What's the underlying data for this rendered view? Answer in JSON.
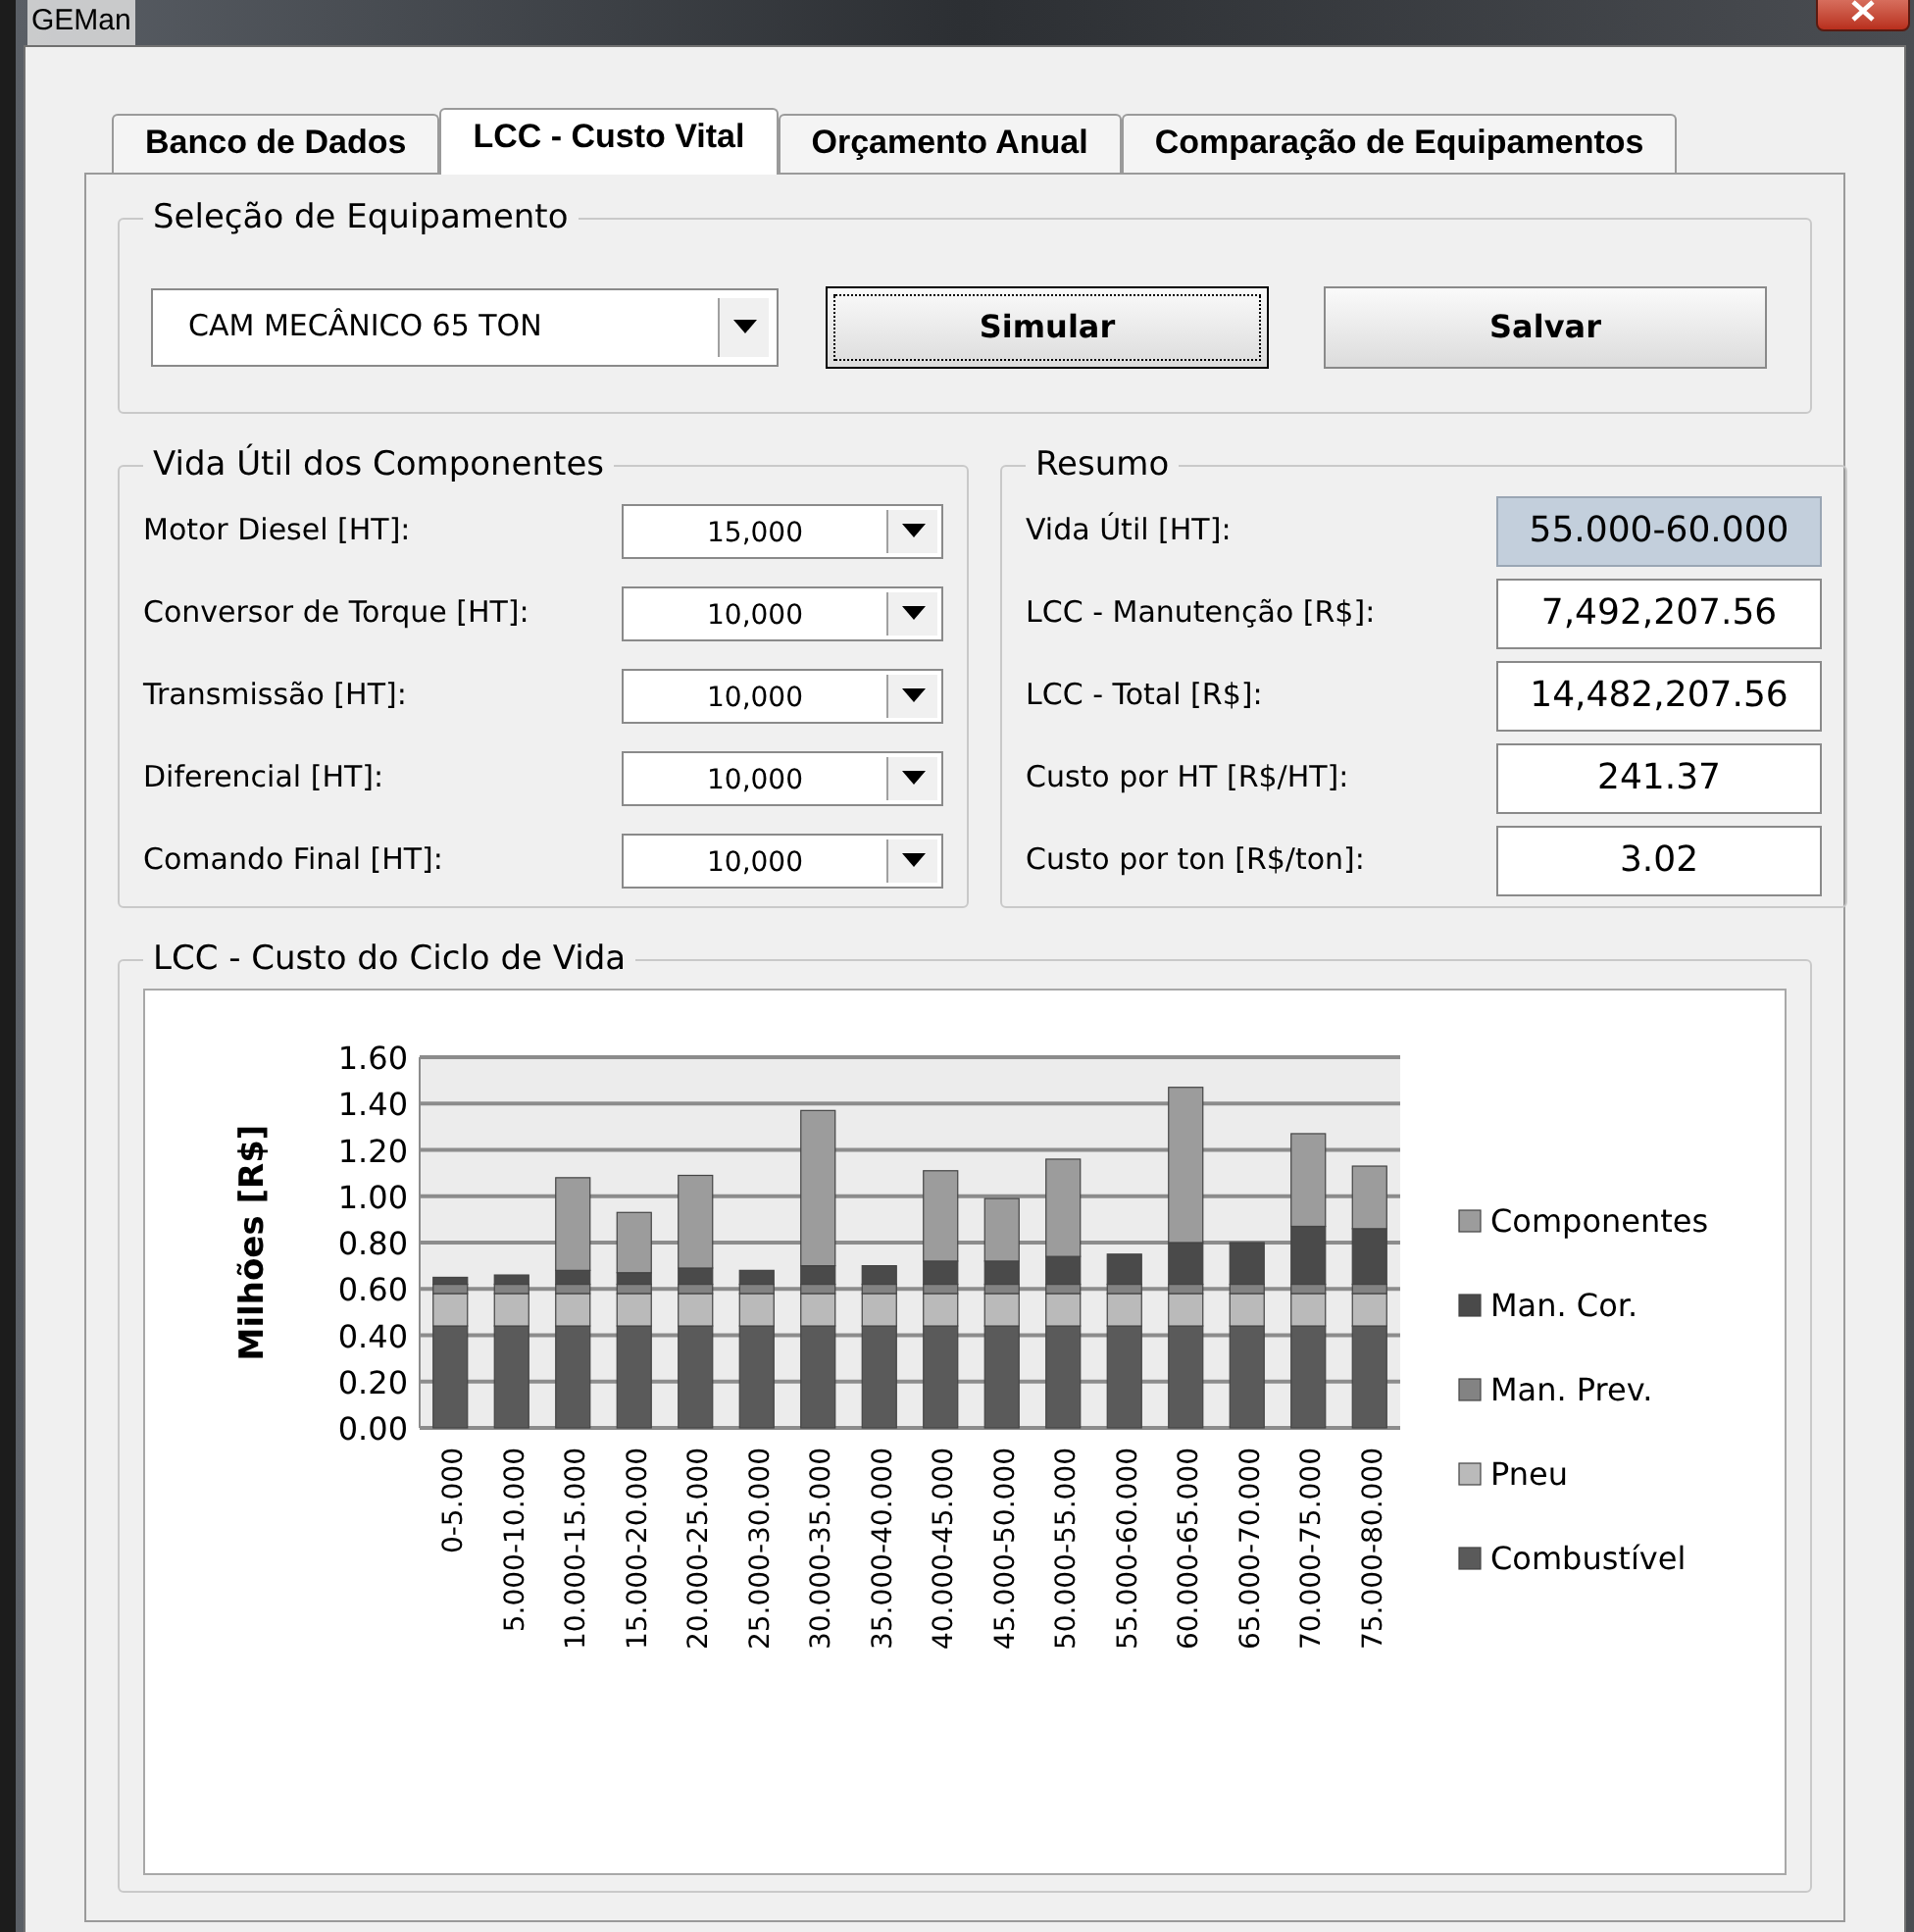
{
  "window": {
    "title": "GEMan"
  },
  "tabs": [
    {
      "label": "Banco de Dados",
      "selected": false
    },
    {
      "label": "LCC - Custo Vital",
      "selected": true
    },
    {
      "label": "Orçamento Anual",
      "selected": false
    },
    {
      "label": "Comparação de Equipamentos",
      "selected": false
    }
  ],
  "equipment": {
    "title": "Seleção de Equipamento",
    "value": "CAM MECÂNICO 65 TON",
    "buttons": [
      {
        "label": "Simular",
        "focused": true
      },
      {
        "label": "Salvar",
        "focused": false
      }
    ]
  },
  "components": {
    "title": "Vida Útil dos Componentes",
    "rows": [
      {
        "label": "Motor Diesel [HT]:",
        "value": "15,000"
      },
      {
        "label": "Conversor de Torque [HT]:",
        "value": "10,000"
      },
      {
        "label": "Transmissão [HT]:",
        "value": "10,000"
      },
      {
        "label": "Diferencial [HT]:",
        "value": "10,000"
      },
      {
        "label": "Comando Final [HT]:",
        "value": "10,000"
      }
    ]
  },
  "summary": {
    "title": "Resumo",
    "rows": [
      {
        "label": "Vida Útil [HT]:",
        "value": "55.000-60.000",
        "readonly": true
      },
      {
        "label": "LCC - Manutenção [R$]:",
        "value": "7,492,207.56",
        "readonly": false
      },
      {
        "label": "LCC - Total [R$]:",
        "value": "14,482,207.56",
        "readonly": false
      },
      {
        "label": "Custo por HT [R$/HT]:",
        "value": "241.37",
        "readonly": false
      },
      {
        "label": "Custo por ton [R$/ton]:",
        "value": "3.02",
        "readonly": false
      }
    ]
  },
  "chart_panel": {
    "title": "LCC - Custo do Ciclo de Vida",
    "chart_data": {
      "type": "bar",
      "stacked": true,
      "grid": true,
      "legend": true,
      "ylabel": "Milhões [R$]",
      "categories": [
        "0-5.000",
        "5.000-10.000",
        "10.000-15.000",
        "15.000-20.000",
        "20.000-25.000",
        "25.000-30.000",
        "30.000-35.000",
        "35.000-40.000",
        "40.000-45.000",
        "45.000-50.000",
        "50.000-55.000",
        "55.000-60.000",
        "60.000-65.000",
        "65.000-70.000",
        "70.000-75.000",
        "75.000-80.000"
      ],
      "ylim": [
        0,
        1.6
      ],
      "yticks": [
        {
          "value": 0,
          "label": "0.00"
        },
        {
          "value": 0.2,
          "label": "0.20"
        },
        {
          "value": 0.4,
          "label": "0.40"
        },
        {
          "value": 0.6,
          "label": "0.60"
        },
        {
          "value": 0.8,
          "label": "0.80"
        },
        {
          "value": 1,
          "label": "1.00"
        },
        {
          "value": 1.2,
          "label": "1.20"
        },
        {
          "value": 1.4,
          "label": "1.40"
        },
        {
          "value": 1.6,
          "label": "1.60"
        }
      ],
      "series": [
        {
          "name": "Combustível",
          "color": "#5a5a5a",
          "values": [
            0.44,
            0.44,
            0.44,
            0.44,
            0.44,
            0.44,
            0.44,
            0.44,
            0.44,
            0.44,
            0.44,
            0.44,
            0.44,
            0.44,
            0.44,
            0.44
          ]
        },
        {
          "name": "Pneu",
          "color": "#bababa",
          "values": [
            0.14,
            0.14,
            0.14,
            0.14,
            0.14,
            0.14,
            0.14,
            0.14,
            0.14,
            0.14,
            0.14,
            0.14,
            0.14,
            0.14,
            0.14,
            0.14
          ]
        },
        {
          "name": "Man. Prev.",
          "color": "#838383",
          "values": [
            0.04,
            0.04,
            0.04,
            0.04,
            0.04,
            0.04,
            0.04,
            0.04,
            0.04,
            0.04,
            0.04,
            0.04,
            0.04,
            0.04,
            0.04,
            0.04
          ]
        },
        {
          "name": "Man. Cor.",
          "color": "#4a4a4a",
          "values": [
            0.03,
            0.04,
            0.06,
            0.05,
            0.07,
            0.06,
            0.08,
            0.08,
            0.1,
            0.1,
            0.12,
            0.13,
            0.18,
            0.18,
            0.25,
            0.24
          ]
        },
        {
          "name": "Componentes",
          "color": "#9c9c9c",
          "values": [
            0,
            0,
            0.4,
            0.26,
            0.4,
            0,
            0.67,
            0,
            0.39,
            0.27,
            0.42,
            0,
            0.67,
            0,
            0.4,
            0.27
          ]
        }
      ]
    }
  }
}
